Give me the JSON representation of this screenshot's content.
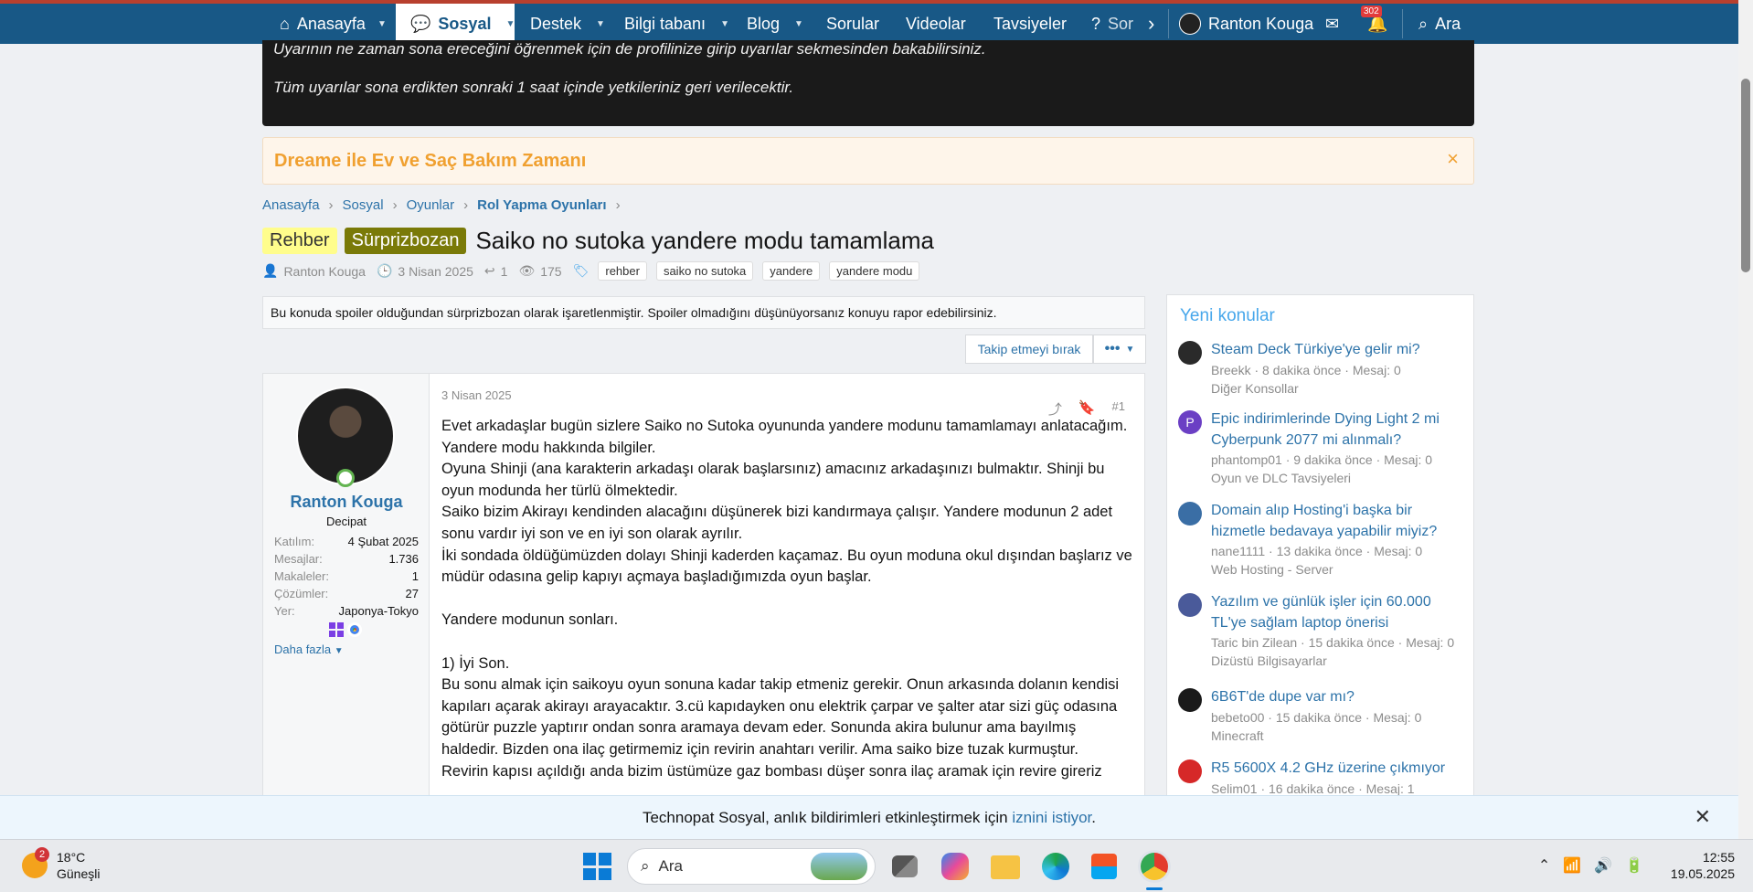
{
  "nav": {
    "items": [
      {
        "label": "Anasayfa"
      },
      {
        "label": "Sosyal"
      },
      {
        "label": "Destek"
      },
      {
        "label": "Bilgi tabanı"
      },
      {
        "label": "Blog"
      },
      {
        "label": "Sorular"
      },
      {
        "label": "Videolar"
      },
      {
        "label": "Tavsiyeler"
      },
      {
        "label": "Sor"
      }
    ],
    "user_name": "Ranton Kouga",
    "alerts_count": "302",
    "search_label": "Ara"
  },
  "notice": {
    "line1": "Uyarının ne zaman sona ereceğini öğrenmek için de profilinize girip uyarılar sekmesinden bakabilirsiniz.",
    "line2": "Tüm uyarılar sona erdikten sonraki 1 saat içinde yetkileriniz geri verilecektir."
  },
  "promo": {
    "text": "Dreame ile Ev ve Saç Bakım Zamanı",
    "close": "×"
  },
  "breadcrumb": [
    "Anasayfa",
    "Sosyal",
    "Oyunlar",
    "Rol Yapma Oyunları"
  ],
  "thread": {
    "prefix1": "Rehber",
    "prefix2": "Sürprizbozan",
    "title": "Saiko no sutoka yandere modu tamamlama",
    "author": "Ranton Kouga",
    "date": "3 Nisan 2025",
    "replies": "1",
    "views": "175",
    "tags": [
      "rehber",
      "saiko no sutoka",
      "yandere",
      "yandere modu"
    ]
  },
  "spoiler_note": "Bu konuda spoiler olduğundan sürprizbozan olarak işaretlenmiştir. Spoiler olmadığını düşünüyorsanız konuyu rapor edebilirsiniz.",
  "follow_label": "Takip etmeyi bırak",
  "more_label": "•••",
  "post": {
    "user": {
      "name": "Ranton Kouga",
      "title": "Decipat",
      "stats": [
        {
          "k": "Katılım:",
          "v": "4 Şubat 2025"
        },
        {
          "k": "Mesajlar:",
          "v": "1.736"
        },
        {
          "k": "Makaleler:",
          "v": "1"
        },
        {
          "k": "Çözümler:",
          "v": "27"
        },
        {
          "k": "Yer:",
          "v": "Japonya-Tokyo"
        }
      ],
      "more": "Daha fazla"
    },
    "date": "3 Nisan 2025",
    "number": "#1",
    "body": [
      "Evet arkadaşlar bugün sizlere Saiko no Sutoka oyununda yandere modunu tamamlamayı anlatacağım.",
      "Yandere modu hakkında bilgiler.",
      "Oyuna Shinji (ana karakterin arkadaşı olarak başlarsınız) amacınız arkadaşınızı bulmaktır. Shinji bu oyun modunda her türlü ölmektedir.",
      "Saiko bizim Akirayı kendinden alacağını düşünerek bizi kandırmaya çalışır. Yandere modunun 2 adet sonu vardır iyi son ve en iyi son olarak ayrılır.",
      "İki sondada öldüğümüzden dolayı Shinji kaderden kaçamaz. Bu oyun moduna okul dışından başlarız ve müdür odasına gelip kapıyı açmaya başladığımızda oyun başlar.",
      "",
      "Yandere modunun sonları.",
      "",
      "1) İyi Son.",
      "Bu sonu almak için saikoyu oyun sonuna kadar takip etmeniz gerekir. Onun arkasında dolanın kendisi kapıları açarak akirayı arayacaktır. 3.cü kapıdayken onu elektrik çarpar ve şalter atar sizi güç odasına götürür puzzle yaptırır ondan sonra aramaya devam eder. Sonunda akira bulunur ama bayılmış haldedir. Bizden ona ilaç getirmemiz için revirin anahtarı verilir. Ama saiko bize tuzak kurmuştur.",
      "Revirin kapısı açıldığı anda bizim üstümüze gaz bombası düşer sonra ilaç aramak için revire gireriz"
    ]
  },
  "sidebar": {
    "title": "Yeni konular",
    "items": [
      {
        "title": "Steam Deck Türkiye'ye gelir mi?",
        "meta": "Breekk · 8 dakika önce · Mesaj: 0",
        "forum": "Diğer Konsollar",
        "color": "#2a2a2a"
      },
      {
        "title": "Epic indirimlerinde Dying Light 2 mi Cyberpunk 2077 mi alınmalı?",
        "meta": "phantomp01 · 9 dakika önce · Mesaj: 0",
        "forum": "Oyun ve DLC Tavsiyeleri",
        "color": "#6b3fc4",
        "initial": "P"
      },
      {
        "title": "Domain alıp Hosting'i başka bir hizmetle bedavaya yapabilir miyiz?",
        "meta": "nane1111 · 13 dakika önce · Mesaj: 0",
        "forum": "Web Hosting - Server",
        "color": "#3a6ea5"
      },
      {
        "title": "Yazılım ve günlük işler için 60.000 TL'ye sağlam laptop önerisi",
        "meta": "Taric bin Zilean · 15 dakika önce · Mesaj: 0",
        "forum": "Dizüstü Bilgisayarlar",
        "color": "#4a5a9a"
      },
      {
        "title": "6B6T'de dupe var mı?",
        "meta": "bebeto00 · 15 dakika önce · Mesaj: 0",
        "forum": "Minecraft",
        "color": "#1a1a1a"
      },
      {
        "title": "R5 5600X 4.2 GHz üzerine çıkmıyor",
        "meta": "Selim01 · 16 dakika önce · Mesaj: 1",
        "forum": "",
        "color": "#d62828"
      }
    ]
  },
  "push": {
    "text": "Technopat Sosyal, anlık bildirimleri etkinleştirmek için ",
    "link": "iznini istiyor",
    "suffix": ".",
    "close": "✕"
  },
  "taskbar": {
    "weather_badge": "2",
    "temp": "18°C",
    "condition": "Güneşli",
    "search": "Ara",
    "time": "12:55",
    "date": "19.05.2025"
  }
}
